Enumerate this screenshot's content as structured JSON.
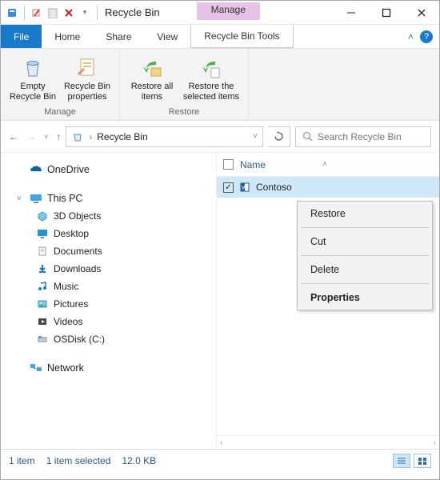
{
  "window": {
    "title": "Recycle Bin",
    "contextual_tab_header": "Manage"
  },
  "tabs": {
    "file": "File",
    "home": "Home",
    "share": "Share",
    "view": "View",
    "recycle_tools": "Recycle Bin Tools"
  },
  "ribbon": {
    "manage": {
      "label": "Manage",
      "empty": "Empty Recycle Bin",
      "properties": "Recycle Bin properties"
    },
    "restore": {
      "label": "Restore",
      "all": "Restore all items",
      "selected": "Restore the selected items"
    }
  },
  "address": {
    "location": "Recycle Bin"
  },
  "search": {
    "placeholder": "Search Recycle Bin"
  },
  "columns": {
    "name": "Name"
  },
  "navpane": {
    "onedrive": "OneDrive",
    "thispc": "This PC",
    "items": [
      "3D Objects",
      "Desktop",
      "Documents",
      "Downloads",
      "Music",
      "Pictures",
      "Videos",
      "OSDisk (C:)"
    ],
    "network": "Network"
  },
  "files": [
    {
      "name": "Contoso",
      "selected": true
    }
  ],
  "context_menu": {
    "restore": "Restore",
    "cut": "Cut",
    "delete": "Delete",
    "properties": "Properties"
  },
  "status": {
    "count": "1 item",
    "selected": "1 item selected",
    "size": "12.0 KB"
  }
}
